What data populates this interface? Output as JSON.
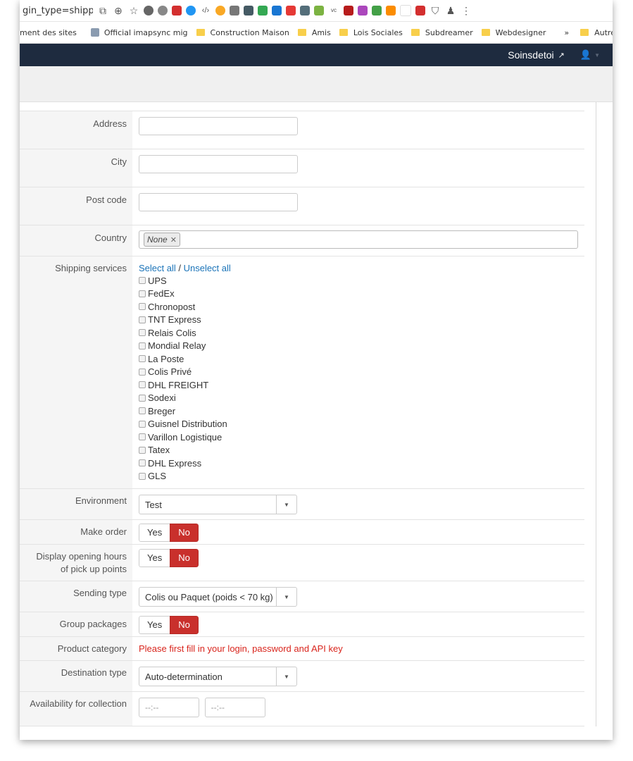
{
  "browser": {
    "url_fragment": "gin_type=shipp...",
    "toolbar_icons": [
      "translate-icon",
      "zoom-icon",
      "star-icon",
      "extension-1-icon",
      "extension-2-icon",
      "lastpass-icon",
      "cloud-icon",
      "code-icon",
      "extension-3-icon",
      "eyedropper-icon",
      "pocket-icon",
      "drive-icon",
      "extension-4-icon",
      "flag-icon",
      "extension-5-icon",
      "joomla-icon",
      "vc-icon",
      "acrobat-icon",
      "extension-6-icon",
      "extension-7-icon",
      "joomla-2-icon",
      "blank-icon",
      "extension-8-icon",
      "bookmark-icon",
      "user-icon",
      "menu-icon"
    ],
    "bookmarks": [
      {
        "label": "ment des sites",
        "type": "site"
      },
      {
        "label": "Official imapsync mig",
        "type": "site"
      },
      {
        "label": "Construction Maison",
        "type": "folder"
      },
      {
        "label": "Amis",
        "type": "folder"
      },
      {
        "label": "Lois Sociales",
        "type": "folder"
      },
      {
        "label": "Subdreamer",
        "type": "folder"
      },
      {
        "label": "Webdesigner",
        "type": "folder"
      }
    ],
    "more_label": "»",
    "other_bookmarks": "Autres favoris"
  },
  "navbar": {
    "shop_name": "Soinsdetoi",
    "ext_glyph": "↗",
    "user_glyph": "👤",
    "caret": "▼"
  },
  "form": {
    "address": {
      "label": "Address",
      "value": ""
    },
    "city": {
      "label": "City",
      "value": ""
    },
    "postcode": {
      "label": "Post code",
      "value": ""
    },
    "country": {
      "label": "Country",
      "tag": "None",
      "remove": "✕"
    },
    "shipping": {
      "label": "Shipping services",
      "select_all": "Select all",
      "separator": " / ",
      "unselect_all": "Unselect all",
      "services": [
        "UPS",
        "FedEx",
        "Chronopost",
        "TNT Express",
        "Relais Colis",
        "Mondial Relay",
        "La Poste",
        "Colis Privé",
        "DHL FREIGHT",
        "Sodexi",
        "Breger",
        "Guisnel Distribution",
        "Varillon Logistique",
        "Tatex",
        "DHL Express",
        "GLS"
      ]
    },
    "environment": {
      "label": "Environment",
      "value": "Test"
    },
    "make_order": {
      "label": "Make order",
      "yes": "Yes",
      "no": "No"
    },
    "opening_hours": {
      "label_line1": "Display opening hours",
      "label_line2": "of pick up points",
      "yes": "Yes",
      "no": "No"
    },
    "sending_type": {
      "label": "Sending type",
      "value": "Colis ou Paquet (poids < 70 kg)"
    },
    "group_packages": {
      "label": "Group packages",
      "yes": "Yes",
      "no": "No"
    },
    "product_category": {
      "label": "Product category",
      "message": "Please first fill in your login, password and API key"
    },
    "destination_type": {
      "label": "Destination type",
      "value": "Auto-determination"
    },
    "availability": {
      "label": "Availability for collection",
      "from_placeholder": "--:--",
      "to_placeholder": "--:--"
    }
  },
  "colors": {
    "navbar": "#1e2b3f",
    "toggle_active": "#c9302c",
    "link": "#1a73b8",
    "error": "#d9251d"
  }
}
